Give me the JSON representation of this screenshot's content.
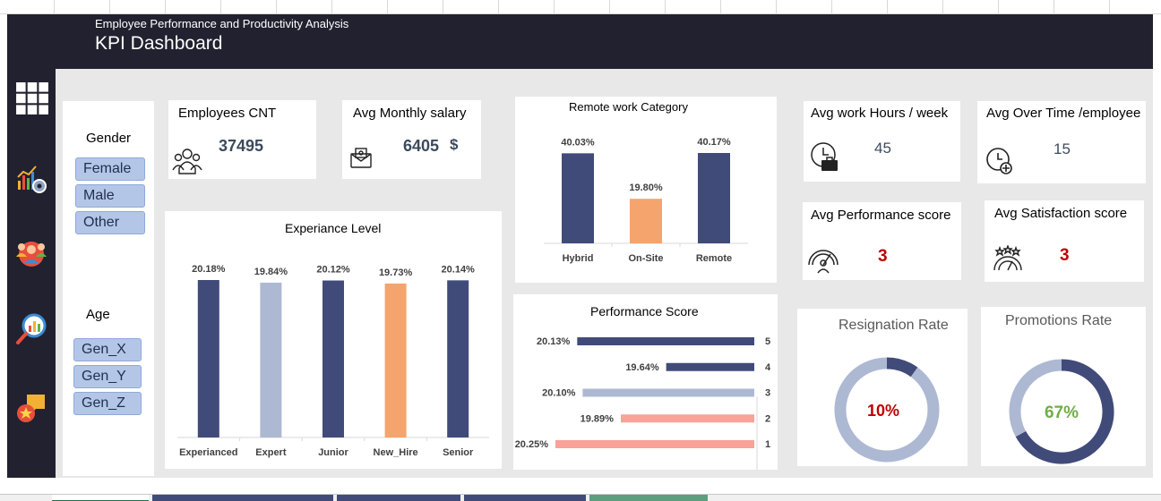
{
  "header": {
    "subtitle": "Employee Performance and Productivity Analysis",
    "title": "KPI Dashboard"
  },
  "slicers": {
    "gender_title": "Gender",
    "gender_items": [
      "Female",
      "Male",
      "Other"
    ],
    "age_title": "Age",
    "age_items": [
      "Gen_X",
      "Gen_Y",
      "Gen_Z"
    ]
  },
  "kpis": {
    "employees": {
      "label": "Employees CNT",
      "value": "37495"
    },
    "salary": {
      "label": "Avg Monthly salary",
      "value": "6405",
      "unit": "$"
    },
    "work_hours": {
      "label": "Avg work Hours / week",
      "value": "45"
    },
    "overtime": {
      "label": "Avg Over Time /employee",
      "value": "15"
    },
    "performance": {
      "label": "Avg Performance score",
      "value": "3"
    },
    "satisfaction": {
      "label": "Avg Satisfaction score",
      "value": "3"
    }
  },
  "charts": {
    "remote": {
      "title": "Remote work Category"
    },
    "experience": {
      "title": "Experiance Level"
    },
    "performance": {
      "title": "Performance Score"
    },
    "resignation": {
      "title": "Resignation Rate",
      "value_label": "10%"
    },
    "promotions": {
      "title": "Promotions Rate",
      "value_label": "67%"
    }
  },
  "colors": {
    "navy": "#414b7a",
    "grey_blue": "#adb9d3",
    "orange": "#f4a46c",
    "salmon": "#f8a29a",
    "red": "#c00000",
    "green": "#70ad47",
    "dark_bg": "#212130"
  },
  "chart_data": [
    {
      "type": "bar",
      "title": "Remote work Category",
      "categories": [
        "Hybrid",
        "On-Site",
        "Remote"
      ],
      "values": [
        40.03,
        19.8,
        40.17
      ],
      "labels": [
        "40.03%",
        "19.80%",
        "40.17%"
      ],
      "colors": [
        "#414b7a",
        "#f4a46c",
        "#414b7a"
      ]
    },
    {
      "type": "bar",
      "title": "Experiance Level",
      "categories": [
        "Experianced",
        "Expert",
        "Junior",
        "New_Hire",
        "Senior"
      ],
      "values": [
        20.18,
        19.84,
        20.12,
        19.73,
        20.14
      ],
      "labels": [
        "20.18%",
        "19.84%",
        "20.12%",
        "19.73%",
        "20.14%"
      ],
      "colors": [
        "#414b7a",
        "#adb9d3",
        "#414b7a",
        "#f4a46c",
        "#414b7a"
      ]
    },
    {
      "type": "bar",
      "orientation": "horizontal",
      "title": "Performance Score",
      "categories": [
        "5",
        "4",
        "3",
        "2",
        "1"
      ],
      "values": [
        20.13,
        19.64,
        20.1,
        19.89,
        20.25
      ],
      "labels": [
        "20.13%",
        "19.64%",
        "20.10%",
        "19.89%",
        "20.25%"
      ],
      "colors": [
        "#414b7a",
        "#414b7a",
        "#adb9d3",
        "#f8a29a",
        "#f8a29a"
      ]
    },
    {
      "type": "pie",
      "title": "Resignation Rate",
      "values": [
        10,
        90
      ],
      "center_label": "10%"
    },
    {
      "type": "pie",
      "title": "Promotions Rate",
      "values": [
        67,
        33
      ],
      "center_label": "67%"
    }
  ]
}
